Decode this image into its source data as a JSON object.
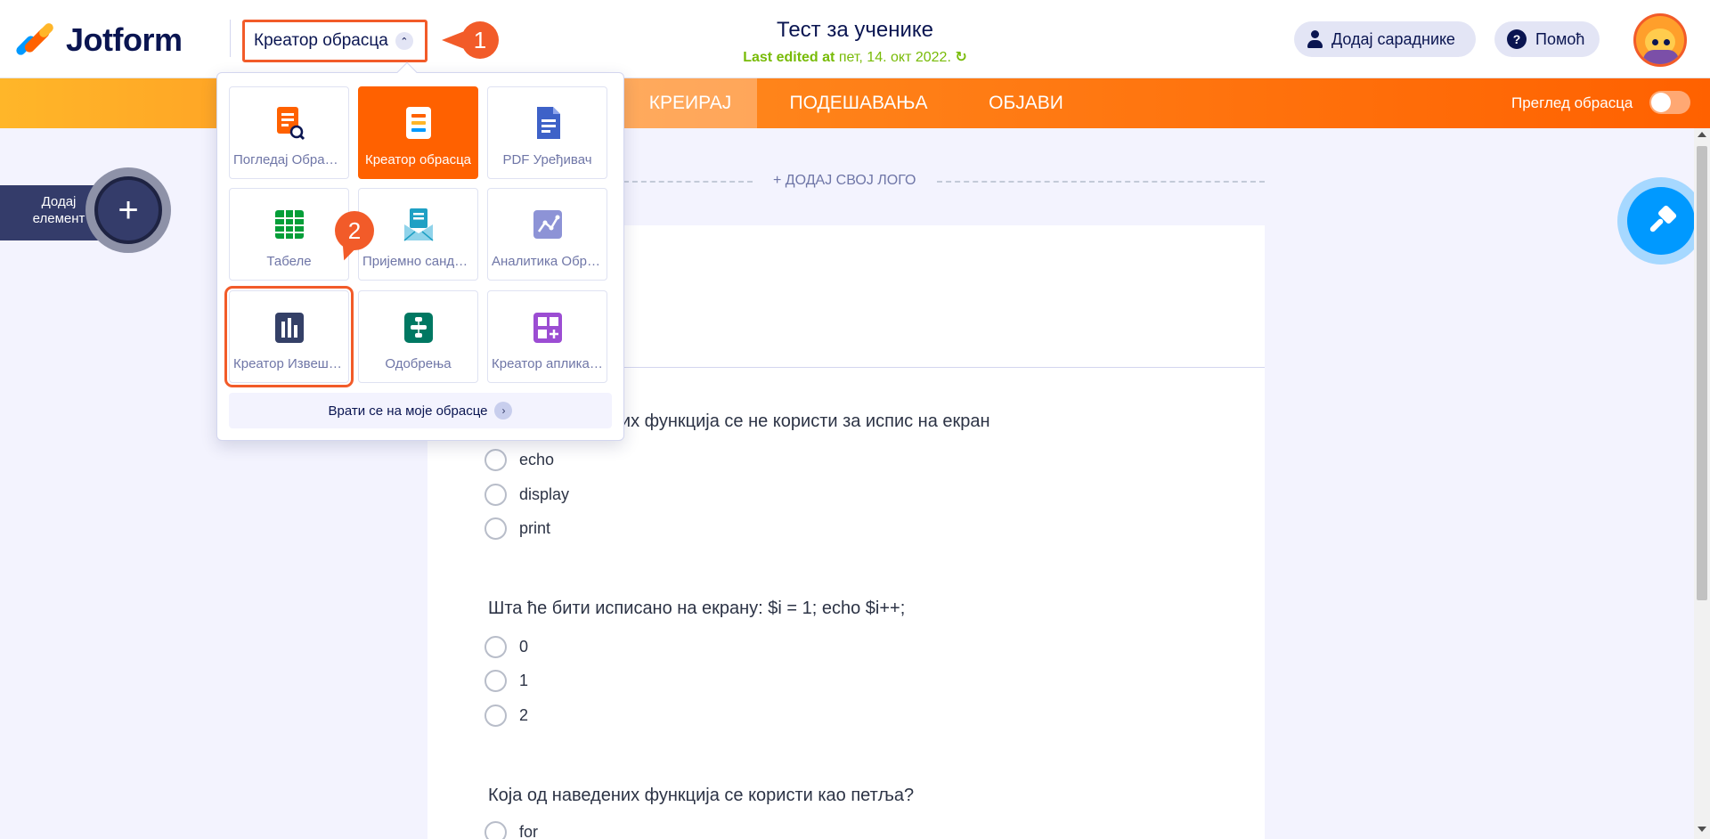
{
  "header": {
    "logo_text": "Jotform",
    "app_switcher_label": "Креатор обрасца",
    "form_title": "Тест за ученике",
    "edited_prefix": "Last edited at",
    "edited_date": "пет, 14. окт 2022.",
    "add_collaborators": "Додај сарадникe",
    "help": "Помоћ",
    "callout_1": "1"
  },
  "nav": {
    "create": "КРЕИРАЈ",
    "settings": "ПОДЕШАВАЊА",
    "publish": "ОБЈАВИ",
    "preview_label": "Преглед обрасца"
  },
  "left_panel": {
    "add_element": "Додај елемент",
    "plus": "+"
  },
  "form": {
    "logo_placeholder": "+ ДОДАЈ СВОЈ ЛОГО",
    "questions": [
      {
        "text": "Која од наведених функција се не користи за испис на екран",
        "options": [
          "echo",
          "display",
          "print"
        ]
      },
      {
        "text": "Шта ће бити исписано на екрану:    $i = 1; echo $i++;",
        "options": [
          "0",
          "1",
          "2"
        ]
      },
      {
        "text": "Која од наведених функција се користи као петља?",
        "options": [
          "for"
        ]
      }
    ]
  },
  "dropdown": {
    "tiles": [
      {
        "label": "Погледај Обрасце",
        "icon": "form-view-icon",
        "color": "#ff6100"
      },
      {
        "label": "Креатор обрасца",
        "icon": "form-builder-icon",
        "color": "#ffffff",
        "active": true
      },
      {
        "label": "PDF Уређивач",
        "icon": "pdf-editor-icon",
        "color": "#3e62c8"
      },
      {
        "label": "Табеле",
        "icon": "tables-icon",
        "color": "#049e38"
      },
      {
        "label": "Пријемно сандуче",
        "icon": "inbox-icon",
        "color": "#1ea0c4"
      },
      {
        "label": "Аналитика Обрасца",
        "icon": "analytics-icon",
        "color": "#8d93d6"
      },
      {
        "label": "Креатор Извештаја",
        "icon": "report-builder-icon",
        "color": "#344067",
        "highlight": true
      },
      {
        "label": "Одобрења",
        "icon": "approvals-icon",
        "color": "#007862"
      },
      {
        "label": "Креатор апликација",
        "icon": "app-builder-icon",
        "color": "#9c4dd3"
      }
    ],
    "back_link": "Врати се на моје обрасце",
    "callout_2": "2"
  },
  "colors": {
    "brand_orange": "#ff6100",
    "navy": "#0a1551",
    "callout": "#f25b29",
    "edited_green": "#78bb07"
  }
}
